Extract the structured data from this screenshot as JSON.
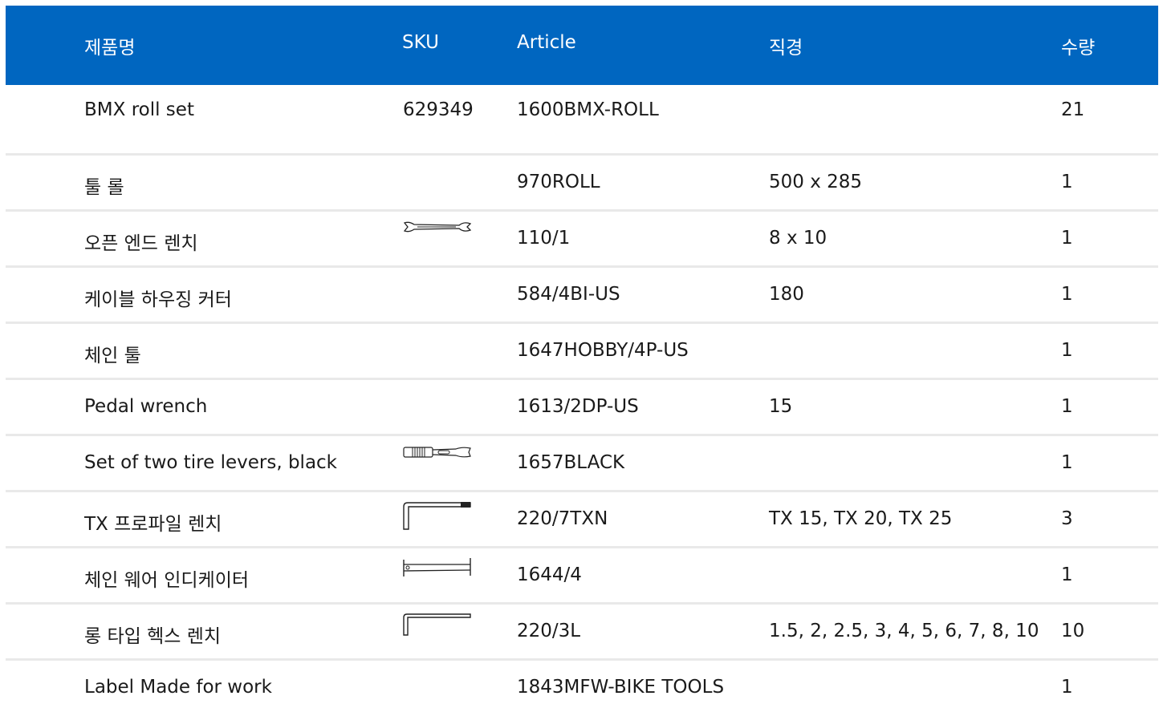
{
  "columns": {
    "name": "제품명",
    "sku": "SKU",
    "article": "Article",
    "diameter": "직경",
    "quantity": "수량"
  },
  "rows": [
    {
      "name": "BMX roll set",
      "sku": "629349",
      "article": "1600BMX-ROLL",
      "diameter": "",
      "quantity": "21",
      "icon": ""
    },
    {
      "name": "툴 롤",
      "sku": "",
      "article": "970ROLL",
      "diameter": "500 x 285",
      "quantity": "1",
      "icon": ""
    },
    {
      "name": "오픈 엔드 렌치",
      "sku": "",
      "article": "110/1",
      "diameter": "8 x 10",
      "quantity": "1",
      "icon": "open-end-wrench-icon"
    },
    {
      "name": "케이블 하우징 커터",
      "sku": "",
      "article": "584/4BI-US",
      "diameter": "180",
      "quantity": "1",
      "icon": ""
    },
    {
      "name": "체인 툴",
      "sku": "",
      "article": "1647HOBBY/4P-US",
      "diameter": "",
      "quantity": "1",
      "icon": ""
    },
    {
      "name": "Pedal wrench",
      "sku": "",
      "article": "1613/2DP-US",
      "diameter": "15",
      "quantity": "1",
      "icon": ""
    },
    {
      "name": "Set of two tire levers, black",
      "sku": "",
      "article": "1657BLACK",
      "diameter": "",
      "quantity": "1",
      "icon": "tire-lever-icon"
    },
    {
      "name": "TX 프로파일 렌치",
      "sku": "",
      "article": "220/7TXN",
      "diameter": "TX 15, TX 20, TX 25",
      "quantity": "3",
      "icon": "torx-key-icon"
    },
    {
      "name": "체인 웨어 인디케이터",
      "sku": "",
      "article": "1644/4",
      "diameter": "",
      "quantity": "1",
      "icon": "chain-wear-indicator-icon"
    },
    {
      "name": "롱 타입 헥스 렌치",
      "sku": "",
      "article": "220/3L",
      "diameter": "1.5, 2, 2.5, 3, 4, 5, 6, 7, 8, 10",
      "quantity": "10",
      "icon": "hex-key-icon"
    },
    {
      "name": "Label Made for work",
      "sku": "",
      "article": "1843MFW-BIKE TOOLS",
      "diameter": "",
      "quantity": "1",
      "icon": ""
    }
  ]
}
